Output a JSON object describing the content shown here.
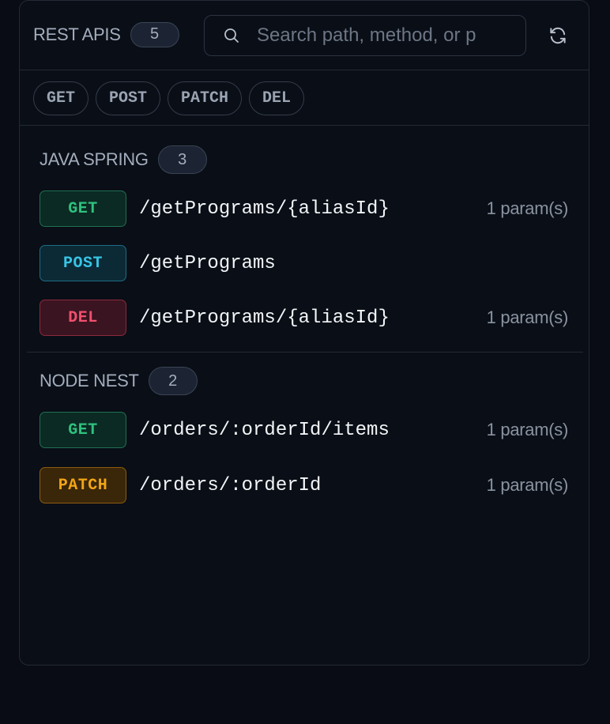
{
  "header": {
    "title": "REST APIS",
    "count": "5",
    "search_placeholder": "Search path, method, or p",
    "search_icon": "search-icon",
    "refresh_icon": "refresh-icon"
  },
  "filters": [
    "GET",
    "POST",
    "PATCH",
    "DEL"
  ],
  "colors": {
    "GET": {
      "text": "#2ec27e",
      "bg": "#0b2a23",
      "border": "#1f6f52"
    },
    "POST": {
      "text": "#38c5e6",
      "bg": "#0b2a36",
      "border": "#1e6c85"
    },
    "DEL": {
      "text": "#f0506e",
      "bg": "#3a1420",
      "border": "#8b2a3e"
    },
    "PATCH": {
      "text": "#f2a516",
      "bg": "#3a2608",
      "border": "#8c5c10"
    }
  },
  "groups": [
    {
      "name": "JAVA SPRING",
      "count": "3",
      "endpoints": [
        {
          "method": "GET",
          "path": "/getPrograms/{aliasId}",
          "params": "1 param(s)"
        },
        {
          "method": "POST",
          "path": "/getPrograms",
          "params": ""
        },
        {
          "method": "DEL",
          "path": "/getPrograms/{aliasId}",
          "params": "1 param(s)"
        }
      ]
    },
    {
      "name": "NODE NEST",
      "count": "2",
      "endpoints": [
        {
          "method": "GET",
          "path": "/orders/:orderId/items",
          "params": "1 param(s)"
        },
        {
          "method": "PATCH",
          "path": "/orders/:orderId",
          "params": "1 param(s)"
        }
      ]
    }
  ]
}
